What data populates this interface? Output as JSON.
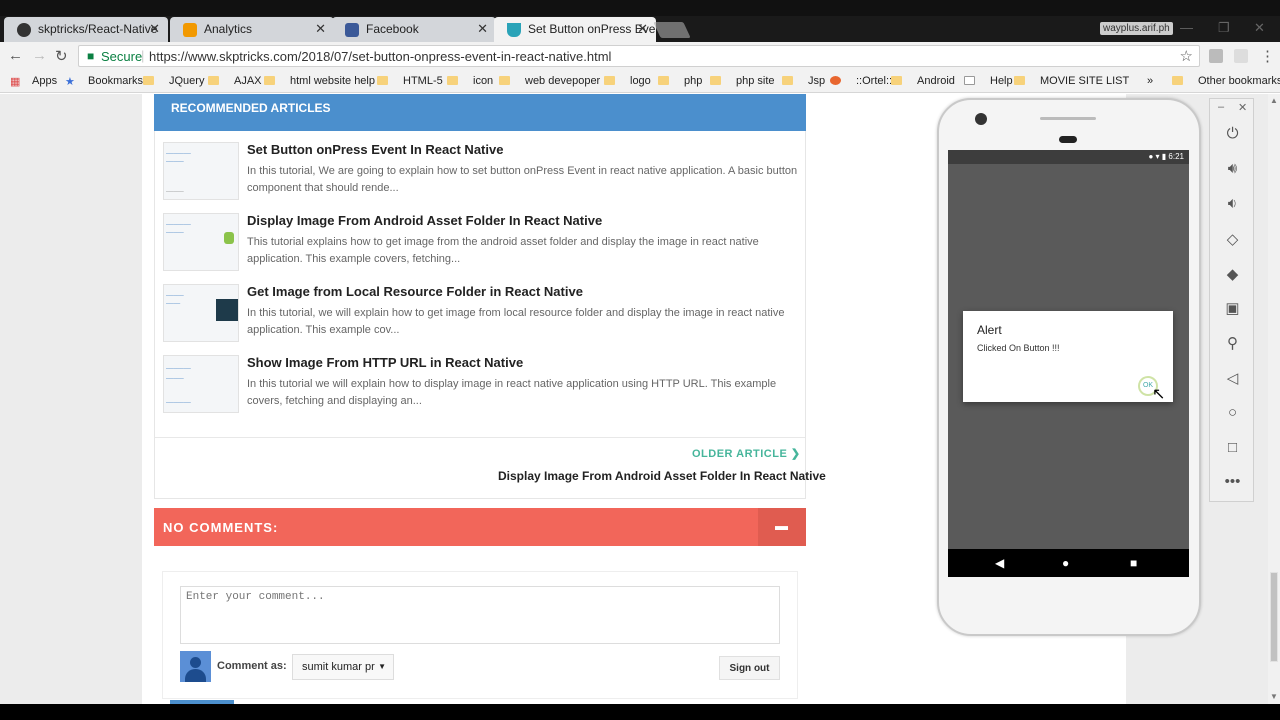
{
  "tabs": [
    {
      "title": "skptricks/React-Native",
      "icon": "github-icon",
      "color": "#333333"
    },
    {
      "title": "Analytics",
      "icon": "analytics-icon",
      "color": "#f29900"
    },
    {
      "title": "Facebook",
      "icon": "facebook-icon",
      "color": "#3b5998"
    },
    {
      "title": "Set Button onPress Event",
      "icon": "flask-icon",
      "color": "#2aa3b8"
    }
  ],
  "profile_label": "wayplus.arif.ph",
  "address": {
    "secure_label": "Secure",
    "url": "https://www.skptricks.com/2018/07/set-button-onpress-event-in-react-native.html"
  },
  "bookmarks": {
    "apps": "Apps",
    "items": [
      "Bookmarks",
      "JQuery",
      "AJAX",
      "html website help",
      "HTML-5",
      "icon",
      "web devepoper",
      "logo",
      "php",
      "php site",
      "Jsp",
      "::Ortel::",
      "Android",
      "Help",
      "MOVIE SITE LIST"
    ],
    "more": "»",
    "other": "Other bookmarks"
  },
  "recommended": {
    "heading": "RECOMMENDED ARTICLES",
    "articles": [
      {
        "title": "Set Button onPress Event In React Native",
        "desc": "In this tutorial, We are going to explain how to set button onPress Event in react native application. A basic button component that should rende..."
      },
      {
        "title": "Display Image From Android Asset Folder In React Native",
        "desc": "This tutorial explains how to get image from the android asset folder and display the image in react native application. This example covers, fetching..."
      },
      {
        "title": "Get Image from Local Resource Folder in React Native",
        "desc": "In this tutorial, we will explain how to get image from local resource folder and display the image in react native application. This example cov..."
      },
      {
        "title": "Show Image From HTTP URL in React Native",
        "desc": "In this tutorial we will explain how to display image in react native application using HTTP URL. This example covers, fetching and displaying an..."
      }
    ]
  },
  "older": {
    "label": "OLDER ARTICLE",
    "title": "Display Image From Android Asset Folder In React Native"
  },
  "comments": {
    "heading": "NO COMMENTS:",
    "placeholder": "Enter your comment...",
    "comment_as": "Comment as:",
    "account": "sumit kumar pr",
    "signout": "Sign out"
  },
  "phone": {
    "time": "6:21",
    "alert_title": "Alert",
    "alert_message": "Clicked On Button !!!",
    "alert_ok": "OK"
  }
}
